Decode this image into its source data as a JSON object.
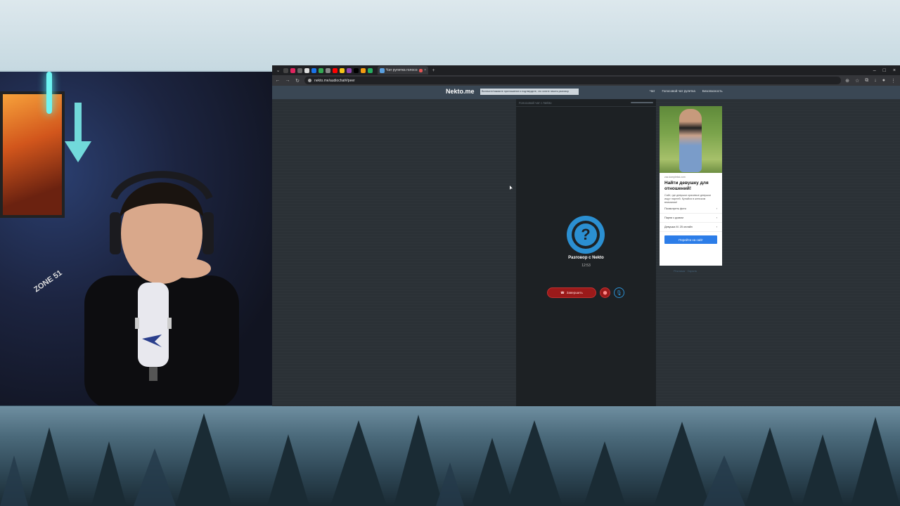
{
  "browser": {
    "tab_title": "Чат рулетка голосовая...",
    "url": "nekto.me/audiochat#/peer",
    "window_controls": [
      "–",
      "□",
      "×"
    ]
  },
  "site": {
    "logo": "Nekto.me",
    "header_notice": "Включите/нажмите приглашение и подтвердите, что хотите начать разговор",
    "nav": [
      "Чат",
      "Голосовой чат рулетка",
      "Безопасность"
    ]
  },
  "chat": {
    "header_title": "Голосовой чат с Nekto",
    "avatar_symbol": "?",
    "conversation_title": "Разговор с Nekto",
    "timer": "12:53",
    "end_button_label": "Завершить"
  },
  "ad": {
    "domain": "zaz-kompleksi.com",
    "title": "Найти девушку для отношений!",
    "description": "Сайт, где девушки красивые девушки ищут парней. Купайся в женском внимании!",
    "links": [
      "Посмотреть фото",
      "Парни с домом",
      "Девушка М. 25 онлайн"
    ],
    "cta": "Перейти на сайт",
    "below_text": "Реклама · Скрыть"
  },
  "webcam": {
    "chair_text": "ZONE 51"
  }
}
